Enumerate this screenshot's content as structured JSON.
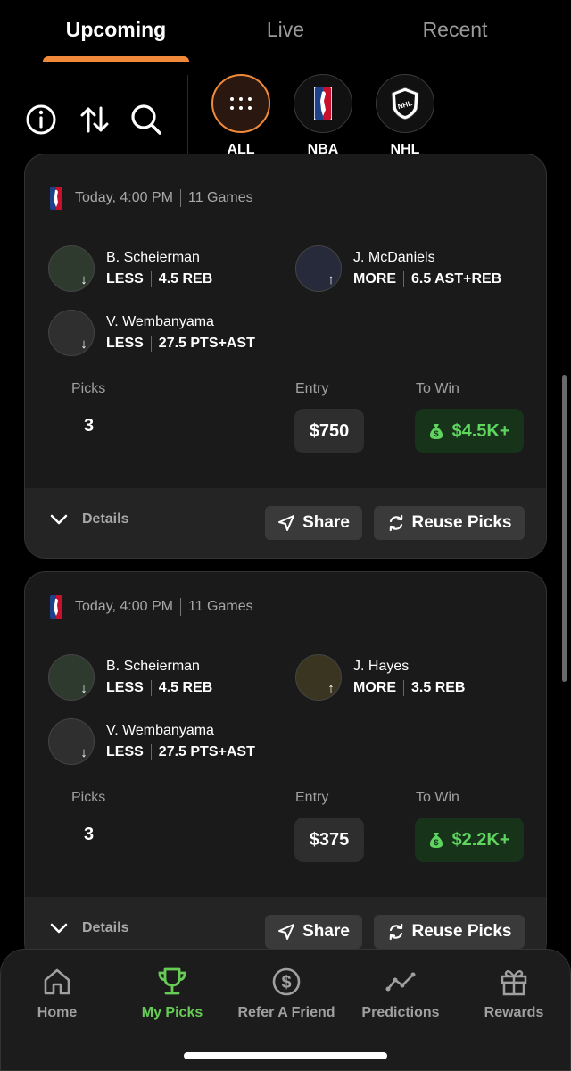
{
  "tabs": [
    {
      "label": "Upcoming",
      "active": true
    },
    {
      "label": "Live",
      "active": false
    },
    {
      "label": "Recent",
      "active": false
    }
  ],
  "filters": {
    "leagues": [
      {
        "label": "ALL",
        "icon": "grid-dots-icon",
        "active": true
      },
      {
        "label": "NBA",
        "icon": "nba-logo",
        "active": false
      },
      {
        "label": "NHL",
        "icon": "nhl-logo",
        "active": false
      }
    ]
  },
  "cards": [
    {
      "header": {
        "time": "Today, 4:00 PM",
        "games": "11 Games"
      },
      "picks": [
        {
          "name": "B. Scheierman",
          "direction": "LESS",
          "line": "4.5 REB",
          "arrow": "↓"
        },
        {
          "name": "J. McDaniels",
          "direction": "MORE",
          "line": "6.5 AST+REB",
          "arrow": "↑"
        },
        {
          "name": "V. Wembanyama",
          "direction": "LESS",
          "line": "27.5 PTS+AST",
          "arrow": "↓"
        }
      ],
      "labels": {
        "picks": "Picks",
        "entry": "Entry",
        "to_win": "To Win"
      },
      "picks_count": "3",
      "entry": "$750",
      "to_win": "$4.5K+",
      "footer": {
        "details": "Details",
        "share": "Share",
        "reuse": "Reuse Picks"
      }
    },
    {
      "header": {
        "time": "Today, 4:00 PM",
        "games": "11 Games"
      },
      "picks": [
        {
          "name": "B. Scheierman",
          "direction": "LESS",
          "line": "4.5 REB",
          "arrow": "↓"
        },
        {
          "name": "J. Hayes",
          "direction": "MORE",
          "line": "3.5 REB",
          "arrow": "↑"
        },
        {
          "name": "V. Wembanyama",
          "direction": "LESS",
          "line": "27.5 PTS+AST",
          "arrow": "↓"
        }
      ],
      "labels": {
        "picks": "Picks",
        "entry": "Entry",
        "to_win": "To Win"
      },
      "picks_count": "3",
      "entry": "$375",
      "to_win": "$2.2K+",
      "footer": {
        "details": "Details",
        "share": "Share",
        "reuse": "Reuse Picks"
      }
    }
  ],
  "bottom_nav": [
    {
      "label": "Home",
      "icon": "home-icon",
      "active": false
    },
    {
      "label": "My Picks",
      "icon": "trophy-icon",
      "active": true
    },
    {
      "label": "Refer A Friend",
      "icon": "dollar-circle-icon",
      "active": false
    },
    {
      "label": "Predictions",
      "icon": "trend-line-icon",
      "active": false
    },
    {
      "label": "Rewards",
      "icon": "gift-icon",
      "active": false
    }
  ],
  "colors": {
    "accent": "#f08a3a",
    "win_green": "#5fd45f",
    "active_nav": "#66cc55",
    "background": "#000000",
    "card": "#1a1a1a"
  }
}
